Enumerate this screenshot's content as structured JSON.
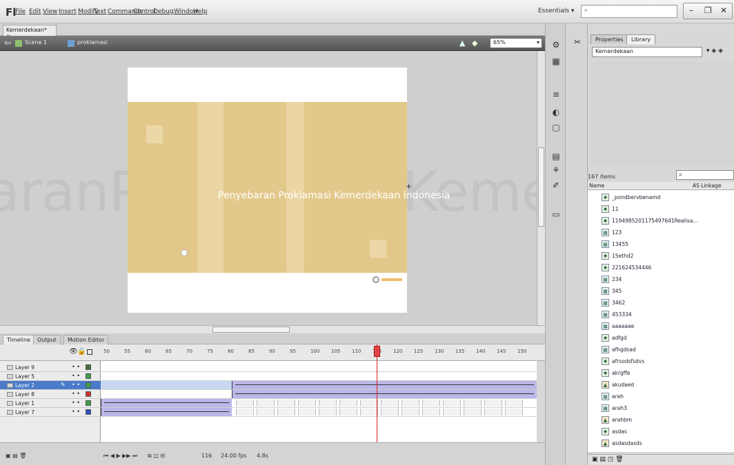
{
  "app": {
    "logo": "Fl",
    "menu": [
      "File",
      "Edit",
      "View",
      "Insert",
      "Modify",
      "Text",
      "Commands",
      "Control",
      "Debug",
      "Window",
      "Help"
    ],
    "workspace": "Essentials ▾"
  },
  "document": {
    "tab": "Kemerdekaan* ×",
    "breadcrumb_scene": "Scene 1",
    "breadcrumb_symbol": "proklamasi",
    "zoom": "65%"
  },
  "stage": {
    "title_text": "Penyebaran Proklamasi Kemerdekaan Indonesia",
    "ghost_text": "aranProklamasiKemerdekaan"
  },
  "timeline": {
    "tabs": [
      "Timeline",
      "Output",
      "Motion Editor"
    ],
    "frame_numbers": [
      "50",
      "55",
      "60",
      "65",
      "70",
      "75",
      "80",
      "85",
      "90",
      "95",
      "100",
      "105",
      "110",
      "115",
      "120",
      "125",
      "130",
      "135",
      "140",
      "145",
      "150"
    ],
    "current_frame_marker": "116",
    "layers": [
      {
        "name": "Layer 9",
        "color": "#4a6a3a",
        "selected": false
      },
      {
        "name": "Layer 5",
        "color": "#3aa04a",
        "selected": false
      },
      {
        "name": "Layer 2",
        "color": "#3aa04a",
        "selected": true
      },
      {
        "name": "Layer 8",
        "color": "#d03030",
        "selected": false
      },
      {
        "name": "Layer 1",
        "color": "#3aa04a",
        "selected": false
      },
      {
        "name": "Layer 7",
        "color": "#3050c0",
        "selected": false
      }
    ],
    "status_fps": "24.00 fps",
    "status_time": "4.8s"
  },
  "panel": {
    "tabs": [
      "Properties",
      "Library"
    ],
    "library_select": "Kemerdekaan",
    "item_count": "167 items",
    "col_name": "Name",
    "col_linkage": "AS Linkage",
    "items": [
      {
        "name": "_pondbervbenamd",
        "kind": "mc"
      },
      {
        "name": "11",
        "kind": "mc"
      },
      {
        "name": "1194985201175497641Realisa...",
        "kind": "mc"
      },
      {
        "name": "123",
        "kind": "graphic"
      },
      {
        "name": "13455",
        "kind": "graphic"
      },
      {
        "name": "15ethd2",
        "kind": "mc"
      },
      {
        "name": "221624534446",
        "kind": "mc"
      },
      {
        "name": "234",
        "kind": "graphic"
      },
      {
        "name": "345",
        "kind": "graphic"
      },
      {
        "name": "3462",
        "kind": "graphic"
      },
      {
        "name": "453334",
        "kind": "graphic"
      },
      {
        "name": "aaaaaae",
        "kind": "graphic"
      },
      {
        "name": "adfgd",
        "kind": "mc"
      },
      {
        "name": "afhgdsad",
        "kind": "graphic"
      },
      {
        "name": "afrsodsfsdvs",
        "kind": "mc"
      },
      {
        "name": "akrgffe",
        "kind": "mc"
      },
      {
        "name": "akudaed",
        "kind": "bmp"
      },
      {
        "name": "arah",
        "kind": "graphic"
      },
      {
        "name": "arah3",
        "kind": "graphic"
      },
      {
        "name": "arahbm",
        "kind": "bmp"
      },
      {
        "name": "asdas",
        "kind": "mc"
      },
      {
        "name": "asdasdasds",
        "kind": "bmp"
      }
    ]
  }
}
